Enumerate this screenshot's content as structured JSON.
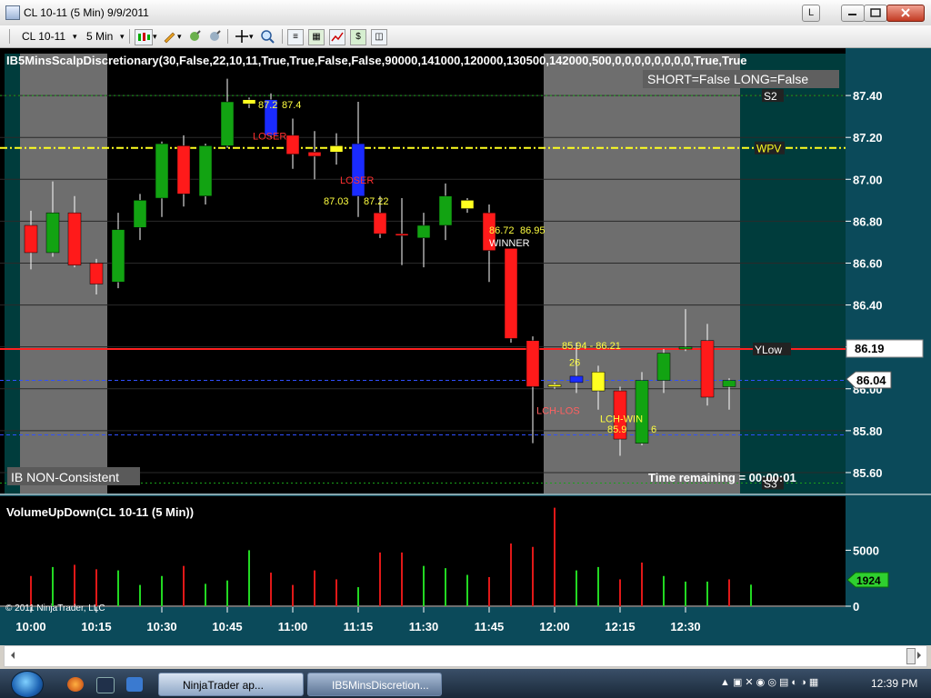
{
  "window": {
    "title": "CL 10-11 (5 Min)  9/9/2011",
    "btn_layout": "L"
  },
  "toolbar": {
    "instrument": "CL 10-11",
    "interval": "5 Min"
  },
  "price_panel": {
    "indicator_title": "IB5MinsScalpDiscretionary(30,False,22,10,11,True,True,False,False,90000,141000,120000,130500,142000,500,0,0,0,0,0,0,0,0,True,True",
    "status_short_long": "SHORT=False LONG=False",
    "ib_status": "IB NON-Consistent",
    "time_remaining": "Time remaining = 00:00:01",
    "y_ticks": [
      "87.40",
      "87.20",
      "87.00",
      "86.80",
      "86.60",
      "86.40",
      "86.20",
      "86.00",
      "85.80",
      "85.60"
    ],
    "ylow_value": "86.19",
    "last_value": "86.04",
    "level_labels": [
      "S2",
      "WPV",
      "YLow",
      "S3"
    ],
    "trade_labels": [
      {
        "text": "87.2",
        "color": "#ffff40"
      },
      {
        "text": "87.4",
        "color": "#ffff40"
      },
      {
        "text": "LOSER",
        "color": "#ff3030"
      },
      {
        "text": "LOSER",
        "color": "#ff3030"
      },
      {
        "text": "87.03",
        "color": "#ffff40"
      },
      {
        "text": "87.22",
        "color": "#ffff40"
      },
      {
        "text": "86.72",
        "color": "#ffff40"
      },
      {
        "text": "86.95",
        "color": "#ffff40"
      },
      {
        "text": "WINNER",
        "color": "#ffffff"
      },
      {
        "text": "85.94 - 86.21",
        "color": "#ffff40"
      },
      {
        "text": "26",
        "color": "#ffff40"
      },
      {
        "text": "LCH-LOS",
        "color": "#ff6060"
      },
      {
        "text": "LCH-WIN",
        "color": "#ffff40"
      },
      {
        "text": "85.9",
        "color": "#ffff40"
      },
      {
        "text": "6",
        "color": "#ffff40"
      }
    ]
  },
  "volume_panel": {
    "title": "VolumeUpDown(CL 10-11 (5 Min))",
    "y_ticks": [
      "5000",
      "0"
    ],
    "last_volume": "1924",
    "copyright": "© 2011 NinjaTrader, LLC"
  },
  "x_axis": {
    "ticks": [
      "10:00",
      "10:15",
      "10:30",
      "10:45",
      "11:00",
      "11:15",
      "11:30",
      "11:45",
      "12:00",
      "12:15",
      "12:30"
    ]
  },
  "chart_data": [
    {
      "type": "candlestick",
      "title": "CL 10-11 (5 Min)",
      "ylim": [
        85.5,
        87.6
      ],
      "x": [
        "9:55",
        "10:00",
        "10:05",
        "10:10",
        "10:15",
        "10:20",
        "10:25",
        "10:30",
        "10:35",
        "10:40",
        "10:45",
        "10:50",
        "10:55",
        "11:00",
        "11:05",
        "11:10",
        "11:15",
        "11:20",
        "11:25",
        "11:30",
        "11:35",
        "11:40",
        "11:45",
        "11:50",
        "11:55",
        "12:00",
        "12:05",
        "12:10",
        "12:15",
        "12:20",
        "12:25",
        "12:30",
        "12:35",
        "12:40"
      ],
      "candles": [
        {
          "o": 86.78,
          "h": 86.85,
          "l": 86.57,
          "c": 86.65,
          "color": "red"
        },
        {
          "o": 86.65,
          "h": 86.99,
          "l": 86.63,
          "c": 86.84,
          "color": "green"
        },
        {
          "o": 86.84,
          "h": 86.92,
          "l": 86.58,
          "c": 86.59,
          "color": "red"
        },
        {
          "o": 86.6,
          "h": 86.62,
          "l": 86.45,
          "c": 86.5,
          "color": "red"
        },
        {
          "o": 86.51,
          "h": 86.84,
          "l": 86.48,
          "c": 86.76,
          "color": "green"
        },
        {
          "o": 86.77,
          "h": 86.93,
          "l": 86.71,
          "c": 86.9,
          "color": "green"
        },
        {
          "o": 86.91,
          "h": 87.18,
          "l": 86.82,
          "c": 87.17,
          "color": "green"
        },
        {
          "o": 87.16,
          "h": 87.21,
          "l": 86.87,
          "c": 86.93,
          "color": "red"
        },
        {
          "o": 86.92,
          "h": 87.17,
          "l": 86.88,
          "c": 87.16,
          "color": "green"
        },
        {
          "o": 87.16,
          "h": 87.48,
          "l": 87.15,
          "c": 87.37,
          "color": "green"
        },
        {
          "o": 87.38,
          "h": 87.39,
          "l": 87.34,
          "c": 87.36,
          "color": "yellow"
        },
        {
          "o": 87.38,
          "h": 87.41,
          "l": 87.2,
          "c": 87.21,
          "color": "blue"
        },
        {
          "o": 87.21,
          "h": 87.29,
          "l": 87.05,
          "c": 87.12,
          "color": "red"
        },
        {
          "o": 87.13,
          "h": 87.23,
          "l": 87.0,
          "c": 87.11,
          "color": "red"
        },
        {
          "o": 87.16,
          "h": 87.22,
          "l": 87.07,
          "c": 87.13,
          "color": "yellow"
        },
        {
          "o": 87.17,
          "h": 87.37,
          "l": 86.82,
          "c": 86.92,
          "color": "blue"
        },
        {
          "o": 86.84,
          "h": 86.92,
          "l": 86.72,
          "c": 86.74,
          "color": "red"
        },
        {
          "o": 86.74,
          "h": 86.91,
          "l": 86.59,
          "c": 86.74,
          "color": "red"
        },
        {
          "o": 86.72,
          "h": 86.84,
          "l": 86.58,
          "c": 86.78,
          "color": "green"
        },
        {
          "o": 86.78,
          "h": 86.98,
          "l": 86.71,
          "c": 86.92,
          "color": "green"
        },
        {
          "o": 86.9,
          "h": 86.91,
          "l": 86.84,
          "c": 86.86,
          "color": "yellow"
        },
        {
          "o": 86.84,
          "h": 86.88,
          "l": 86.51,
          "c": 86.66,
          "color": "red"
        },
        {
          "o": 86.67,
          "h": 86.67,
          "l": 86.22,
          "c": 86.24,
          "color": "red"
        },
        {
          "o": 86.23,
          "h": 86.25,
          "l": 85.74,
          "c": 86.01,
          "color": "red"
        },
        {
          "o": 86.02,
          "h": 86.03,
          "l": 86.0,
          "c": 86.01,
          "color": "yellow"
        },
        {
          "o": 86.06,
          "h": 86.22,
          "l": 85.98,
          "c": 86.03,
          "color": "blue"
        },
        {
          "o": 86.08,
          "h": 86.11,
          "l": 85.9,
          "c": 85.99,
          "color": "yellow"
        },
        {
          "o": 85.99,
          "h": 86.01,
          "l": 85.68,
          "c": 85.76,
          "color": "red"
        },
        {
          "o": 85.74,
          "h": 86.08,
          "l": 85.73,
          "c": 86.04,
          "color": "green"
        },
        {
          "o": 86.04,
          "h": 86.19,
          "l": 85.98,
          "c": 86.17,
          "color": "green"
        },
        {
          "o": 86.19,
          "h": 86.38,
          "l": 86.18,
          "c": 86.2,
          "color": "green"
        },
        {
          "o": 86.23,
          "h": 86.31,
          "l": 85.92,
          "c": 85.96,
          "color": "red"
        },
        {
          "o": 86.01,
          "h": 86.05,
          "l": 85.9,
          "c": 86.04,
          "color": "green"
        }
      ],
      "levels": [
        {
          "name": "S2",
          "value": 87.4,
          "style": "dotted",
          "color": "#1aa11a"
        },
        {
          "name": "WPV",
          "value": 87.15,
          "style": "dashdot",
          "color": "#ffff20"
        },
        {
          "name": "YLow",
          "value": 86.19,
          "style": "solid",
          "color": "#ff2020"
        },
        {
          "name": "S3",
          "value": 85.55,
          "style": "dotted",
          "color": "#1aa11a"
        },
        {
          "name": "level-86.04",
          "value": 86.04,
          "style": "dashed",
          "color": "#3050ff"
        },
        {
          "name": "level-85.78",
          "value": 85.78,
          "style": "dashed",
          "color": "#3050ff"
        }
      ]
    },
    {
      "type": "bar",
      "title": "VolumeUpDown(CL 10-11 (5 Min))",
      "ylim": [
        0,
        9500
      ],
      "categories": [
        "9:55",
        "10:00",
        "10:05",
        "10:10",
        "10:15",
        "10:20",
        "10:25",
        "10:30",
        "10:35",
        "10:40",
        "10:45",
        "10:50",
        "10:55",
        "11:00",
        "11:05",
        "11:10",
        "11:15",
        "11:20",
        "11:25",
        "11:30",
        "11:35",
        "11:40",
        "11:45",
        "11:50",
        "11:55",
        "12:00",
        "12:05",
        "12:10",
        "12:15",
        "12:20",
        "12:25",
        "12:30",
        "12:35",
        "12:40"
      ],
      "series": [
        {
          "values": [
            2700,
            3500,
            3700,
            3300,
            3200,
            1900,
            2700,
            3600,
            2000,
            2300,
            5000,
            3000,
            1900,
            3200,
            2400,
            1700,
            4800,
            4800,
            3600,
            3400,
            2800,
            2600,
            5600,
            5300,
            8800,
            3200,
            3500,
            2400,
            3900,
            2700,
            2200,
            2200,
            2400,
            1924
          ]
        },
        {
          "values": [
            "down",
            "up",
            "down",
            "down",
            "up",
            "up",
            "up",
            "down",
            "up",
            "up",
            "up",
            "down",
            "down",
            "down",
            "down",
            "up",
            "down",
            "down",
            "up",
            "up",
            "up",
            "down",
            "down",
            "down",
            "down",
            "up",
            "up",
            "down",
            "down",
            "up",
            "up",
            "up",
            "down",
            "up"
          ]
        }
      ]
    }
  ],
  "taskbar": {
    "tasks": [
      "NinjaTrader ap...",
      "IB5MinsDiscretion..."
    ],
    "clock": "12:39 PM"
  }
}
